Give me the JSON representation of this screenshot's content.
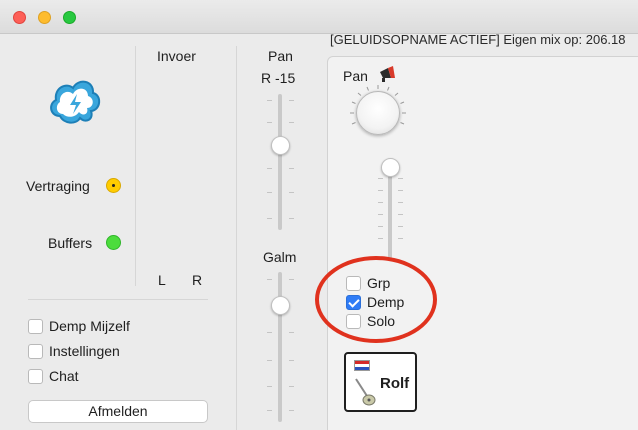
{
  "window": {
    "status_text": "[GELUIDSOPNAME ACTIEF] Eigen mix op: 206.18"
  },
  "left_panel": {
    "input_label": "Invoer",
    "delay_label": "Vertraging",
    "buffers_label": "Buffers",
    "channel_left": "L",
    "channel_right": "R",
    "checkboxes": [
      {
        "label": "Demp Mijzelf",
        "checked": false
      },
      {
        "label": "Instellingen",
        "checked": false
      },
      {
        "label": "Chat",
        "checked": false
      }
    ],
    "logout_button": "Afmelden",
    "indicator_colors": {
      "delay": "#ffcc00",
      "buffers": "#4cdc3c"
    }
  },
  "master_column": {
    "pan_label": "Pan",
    "pan_value": "R -15",
    "reverb_label": "Galm"
  },
  "channel_strip": {
    "pan_label": "Pan",
    "pan_icon": "megaphone-icon",
    "options": [
      {
        "label": "Grp",
        "checked": false
      },
      {
        "label": "Demp",
        "checked": true
      },
      {
        "label": "Solo",
        "checked": false
      }
    ],
    "user_name": "Rolf",
    "user_icon": "guitar-icon",
    "user_flag": "netherlands-flag-icon",
    "highlight_color": "#e0321e"
  }
}
